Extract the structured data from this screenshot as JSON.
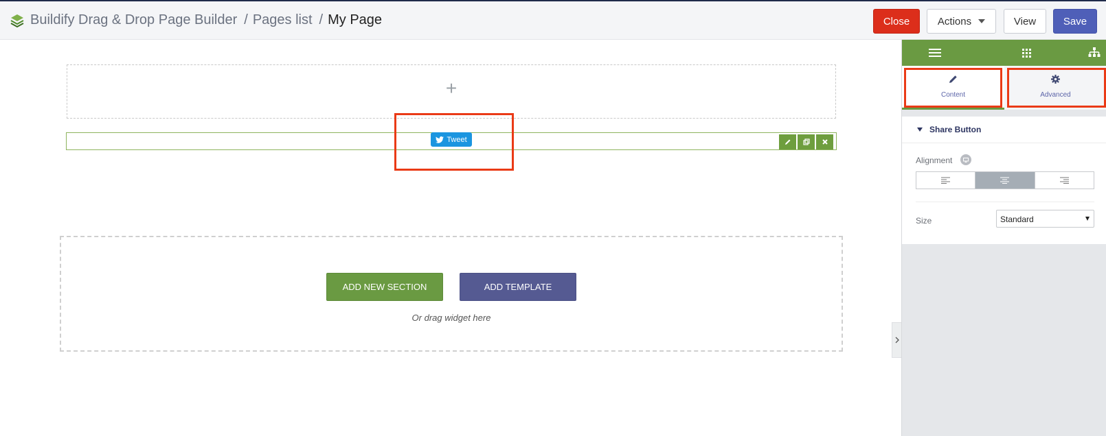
{
  "header": {
    "app_title": "Buildify Drag & Drop Page Builder",
    "sep1": "/",
    "pages_list": "Pages list",
    "sep2": "/",
    "current_page": "My Page",
    "buttons": {
      "close": "Close",
      "actions": "Actions",
      "view": "View",
      "save": "Save"
    }
  },
  "canvas": {
    "empty_section_icon": "+",
    "tweet_button": "Tweet",
    "add_new_section": "ADD NEW SECTION",
    "add_template": "ADD TEMPLATE",
    "drag_hint": "Or drag widget here"
  },
  "panel": {
    "tabs": {
      "content": "Content",
      "advanced": "Advanced"
    },
    "section_title": "Share Button",
    "alignment_label": "Alignment",
    "alignment_options": [
      "left",
      "center",
      "right"
    ],
    "alignment_selected": "center",
    "size_label": "Size",
    "size_value": "Standard"
  },
  "colors": {
    "accent_green": "#6a9a42",
    "save_blue": "#4f5fb8",
    "close_red": "#dc2e1b",
    "twitter_blue": "#1b95e0",
    "template_purple": "#555a92",
    "highlight_red": "#ea3a16"
  }
}
